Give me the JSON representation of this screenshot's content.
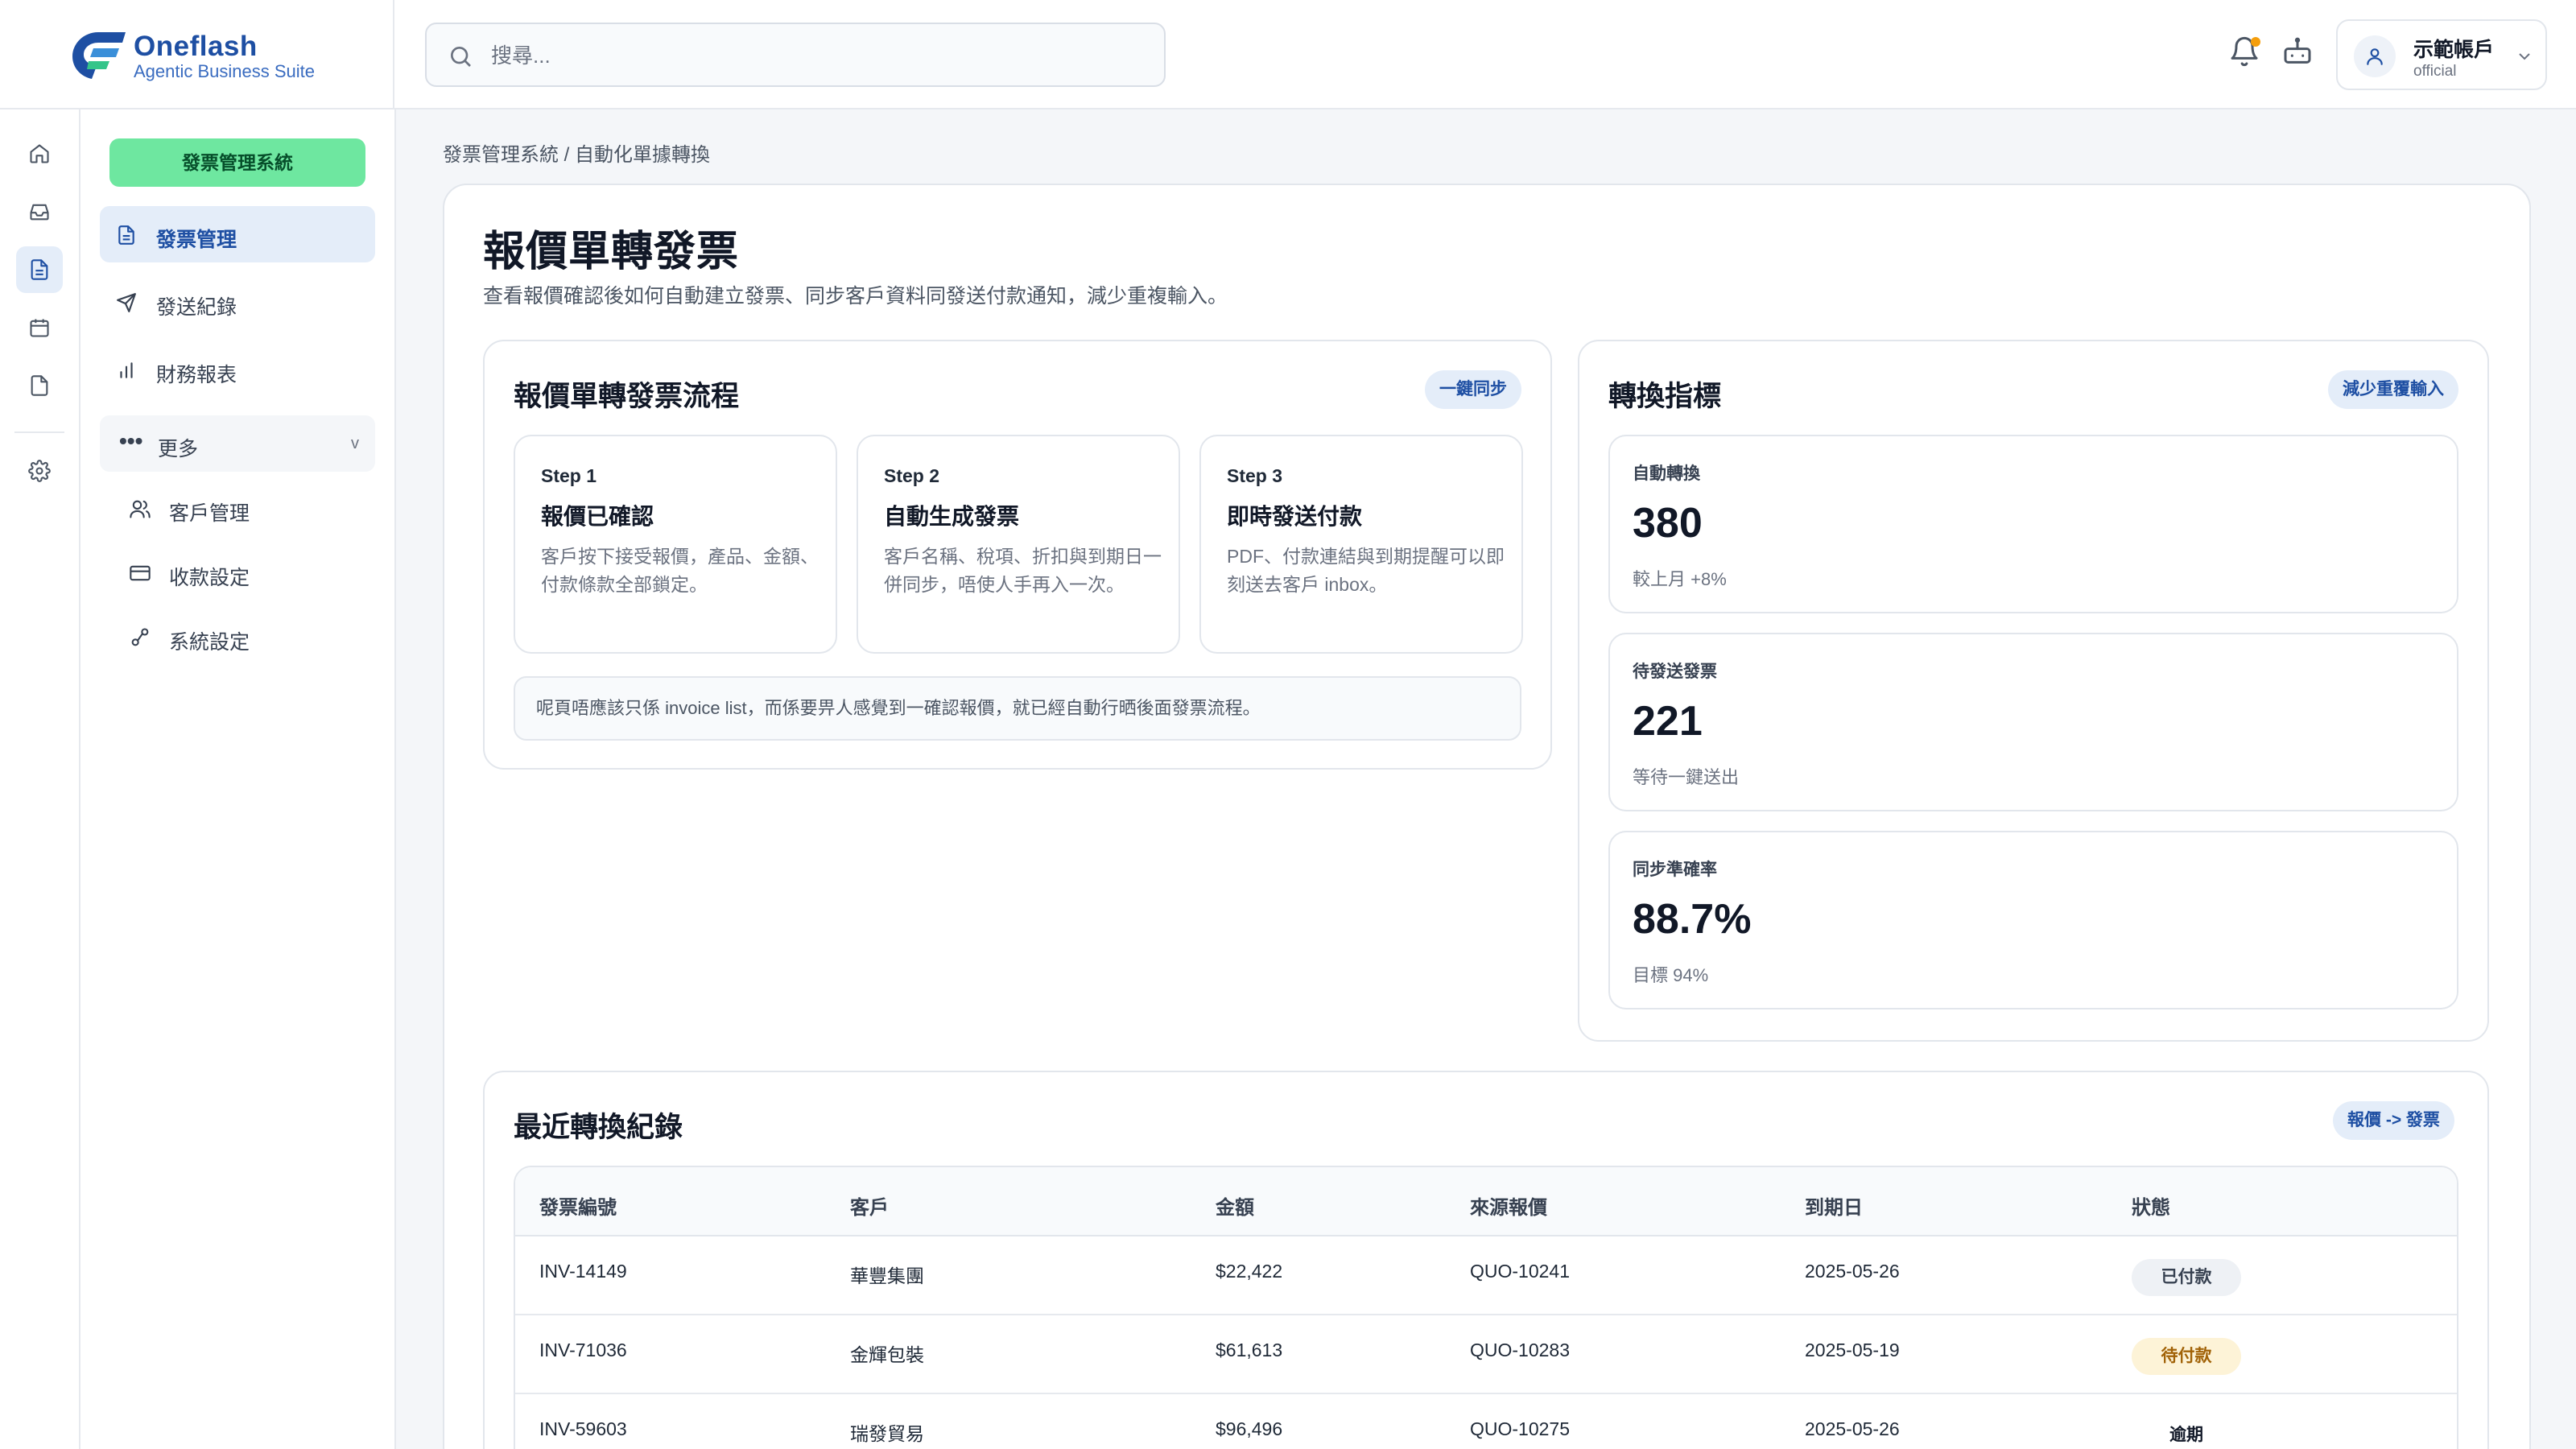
{
  "brand": {
    "name": "Oneflash",
    "tagline": "Agentic Business Suite"
  },
  "search": {
    "placeholder": "搜尋..."
  },
  "account": {
    "name": "示範帳戶",
    "role": "official"
  },
  "sidebar": {
    "system_label": "發票管理系統",
    "items": [
      {
        "label": "發票管理",
        "icon": "document-icon"
      },
      {
        "label": "發送紀錄",
        "icon": "send-icon"
      },
      {
        "label": "財務報表",
        "icon": "bar-chart-icon"
      }
    ],
    "more": {
      "dots": "•••",
      "label": "更多",
      "chevron": "v"
    },
    "sub_items": [
      {
        "label": "客戶管理",
        "icon": "users-icon"
      },
      {
        "label": "收款設定",
        "icon": "credit-card-icon"
      },
      {
        "label": "系統設定",
        "icon": "settings-nodes-icon"
      }
    ]
  },
  "breadcrumb": "發票管理系統 / 自動化單據轉換",
  "page": {
    "title": "報價單轉發票",
    "subtitle": "查看報價確認後如何自動建立發票、同步客戶資料同發送付款通知，減少重複輸入。"
  },
  "flow": {
    "title": "報價單轉發票流程",
    "chip": "一鍵同步",
    "steps": [
      {
        "no": "Step 1",
        "title": "報價已確認",
        "desc": "客戶按下接受報價，產品、金額、付款條款全部鎖定。"
      },
      {
        "no": "Step 2",
        "title": "自動生成發票",
        "desc": "客戶名稱、稅項、折扣與到期日一併同步，唔使人手再入一次。"
      },
      {
        "no": "Step 3",
        "title": "即時發送付款",
        "desc": "PDF、付款連結與到期提醒可以即刻送去客戶 inbox。"
      }
    ],
    "note": "呢頁唔應該只係 invoice list，而係要畀人感覺到一確認報價，就已經自動行晒後面發票流程。"
  },
  "metrics": {
    "title": "轉換指標",
    "chip": "減少重覆輸入",
    "cards": [
      {
        "label": "自動轉換",
        "value": "380",
        "sub": "較上月 +8%"
      },
      {
        "label": "待發送發票",
        "value": "221",
        "sub": "等待一鍵送出"
      },
      {
        "label": "同步準確率",
        "value": "88.7%",
        "sub": "目標 94%"
      }
    ]
  },
  "recent": {
    "title": "最近轉換紀錄",
    "chip": "報價 -> 發票",
    "columns": [
      "發票編號",
      "客戶",
      "金額",
      "來源報價",
      "到期日",
      "狀態"
    ],
    "rows": [
      {
        "invoice": "INV-14149",
        "client": "華豐集團",
        "amount": "$22,422",
        "quote": "QUO-10241",
        "due": "2025-05-26",
        "status": "已付款"
      },
      {
        "invoice": "INV-71036",
        "client": "金輝包裝",
        "amount": "$61,613",
        "quote": "QUO-10283",
        "due": "2025-05-19",
        "status": "待付款"
      },
      {
        "invoice": "INV-59603",
        "client": "瑞發貿易",
        "amount": "$96,496",
        "quote": "QUO-10275",
        "due": "2025-05-26",
        "status": "逾期"
      }
    ]
  },
  "colors": {
    "accent": "#1e4fa3",
    "system_pill": "#6ee7a0",
    "active_bg": "#e4edf9",
    "status_paid_bg": "#eef1f5",
    "status_pending_bg": "#fdf3d7",
    "notification_dot": "#f59e0b"
  }
}
